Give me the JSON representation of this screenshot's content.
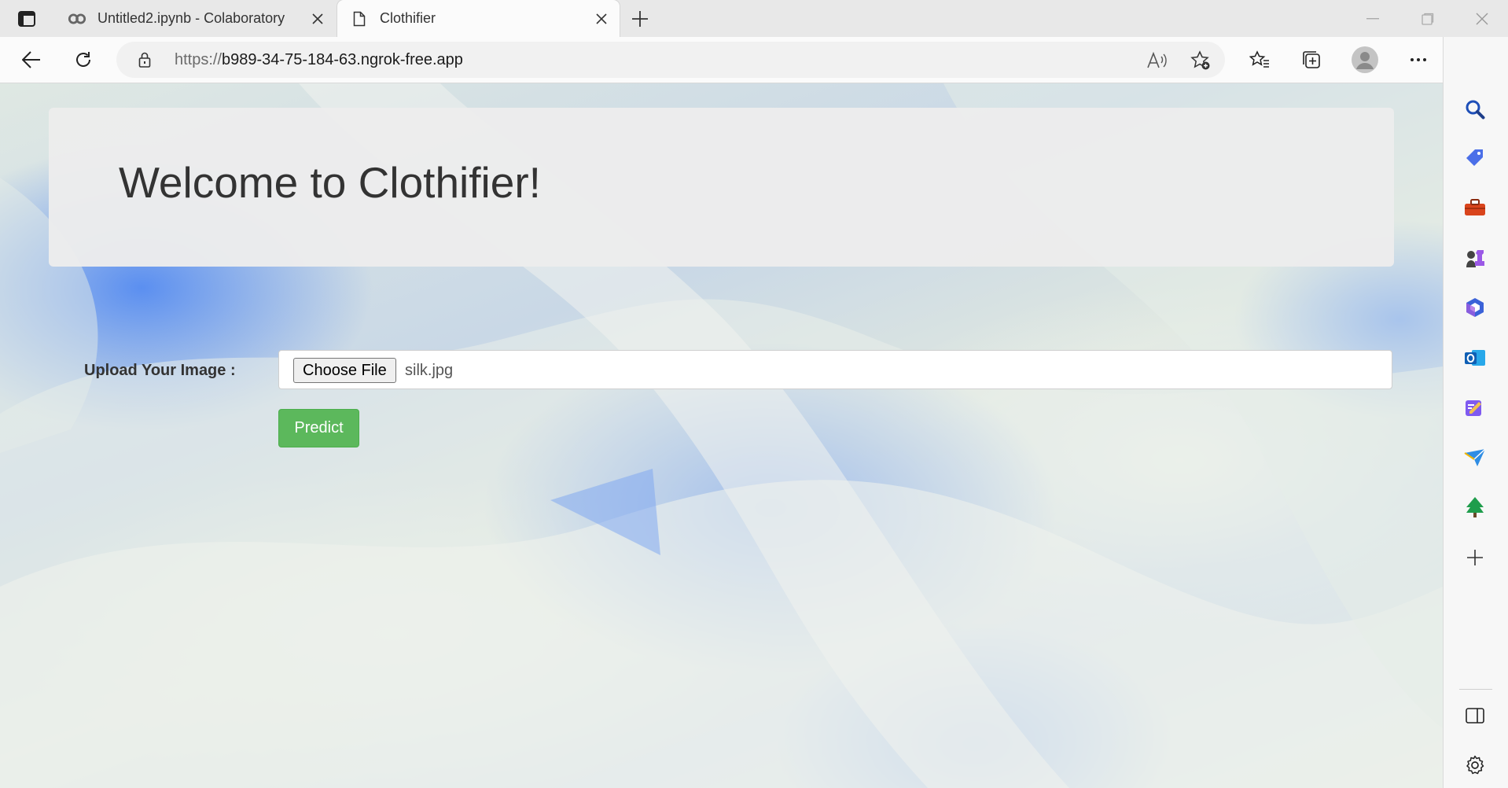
{
  "browser": {
    "tabs": [
      {
        "title": "Untitled2.ipynb - Colaboratory",
        "icon": "colab-icon",
        "active": false
      },
      {
        "title": "Clothifier",
        "icon": "page-icon",
        "active": true
      }
    ],
    "address": {
      "scheme": "https://",
      "host": "b989-34-75-184-63.ngrok-free.app"
    }
  },
  "page": {
    "heading": "Welcome to Clothifier!",
    "upload_label": "Upload Your Image :",
    "choose_file_label": "Choose File",
    "selected_file": "silk.jpg",
    "predict_label": "Predict"
  },
  "colors": {
    "predict_button": "#5cb85c",
    "jumbotron_bg": "#ececec",
    "heading_text": "#333333"
  },
  "sidebar_icons": [
    "search-icon",
    "shopping-tag-icon",
    "tools-icon",
    "games-icon",
    "microsoft365-icon",
    "outlook-icon",
    "designer-icon",
    "drop-send-icon",
    "tree-icon",
    "add-icon",
    "split-screen-icon",
    "settings-icon"
  ]
}
